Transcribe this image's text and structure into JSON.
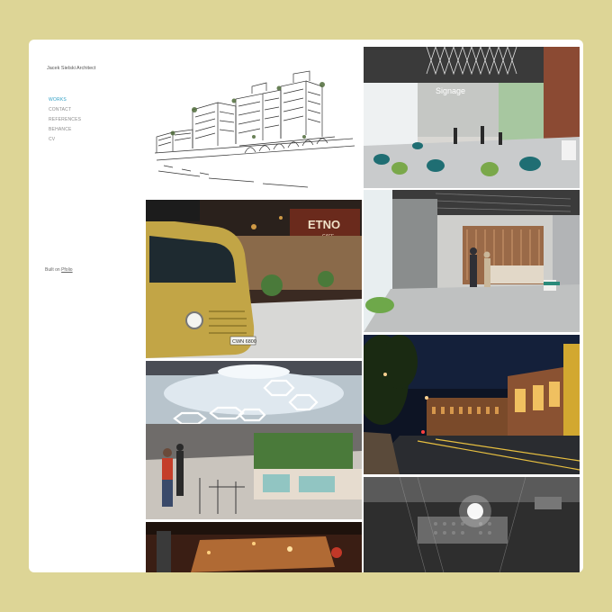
{
  "site": {
    "title": "Jacek Sielski Architect"
  },
  "nav": {
    "items": [
      {
        "label": "WORKS",
        "active": true
      },
      {
        "label": "CONTACT",
        "active": false
      },
      {
        "label": "REFERENCES",
        "active": false
      },
      {
        "label": "BEHANCE",
        "active": false
      },
      {
        "label": "CV",
        "active": false
      }
    ]
  },
  "footer": {
    "built_text": "Built on",
    "built_link": "Pfolio"
  },
  "gallery": {
    "cafe_sign": "ETNO",
    "cafe_sign_sub": "CAFE",
    "truck_plate": "CWN 6800",
    "office_sign": "Signage"
  },
  "colors": {
    "background": "#ddd596",
    "card": "#ffffff",
    "nav_active": "#2f9fc5",
    "nav_inactive": "#8a8a8a"
  }
}
